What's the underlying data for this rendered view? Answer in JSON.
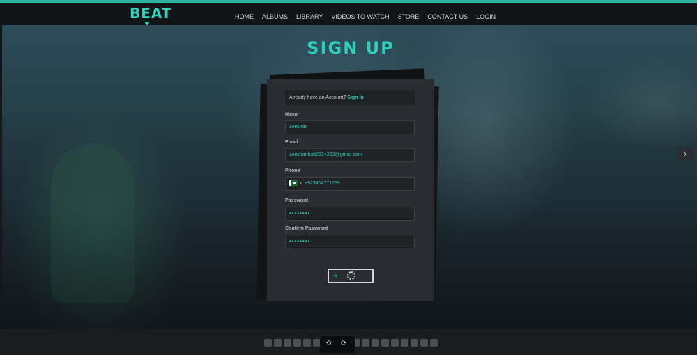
{
  "brand": {
    "name": "BEAT",
    "accent": "#2fc7b3"
  },
  "nav": {
    "items": [
      "HOME",
      "ALBUMS",
      "LIBRARY",
      "VIDEOS TO WATCH",
      "STORE",
      "CONTACT US",
      "LOGIN"
    ]
  },
  "hero": {
    "title": "SIGN UP",
    "next_icon": "chevron-right-icon",
    "next_glyph": "›"
  },
  "form": {
    "signin_text": "Already have an Account?",
    "signin_link": "Sign In",
    "name": {
      "label": "Name",
      "value": "zeeshan"
    },
    "email": {
      "label": "Email",
      "value": "zeeshanbutt223+222@gmail.com"
    },
    "phone": {
      "label": "Phone",
      "value": "+923454771299",
      "country": "PK"
    },
    "password": {
      "label": "Password",
      "value": "••••••••"
    },
    "confirm_password": {
      "label": "Confirm Password",
      "value": "••••••••"
    },
    "submit": {
      "icon": "sign-in-icon",
      "glyph": "⇥",
      "state": "loading"
    }
  },
  "footer": {
    "social_icons": [
      "youtube-icon",
      "twitter-icon",
      "facebook-icon",
      "facebook-icon",
      "instagram-icon",
      "amazon-icon",
      "beatport-icon",
      "tidal-icon",
      "tiktok-icon",
      "soundcloud-icon",
      "deezer-icon",
      "spotify-icon",
      "itunes-icon",
      "bandcamp-icon",
      "google-play-icon",
      "mixcloud-icon",
      "napster-icon",
      "shazam-icon"
    ],
    "player": {
      "prev_icon": "undo-icon",
      "prev_glyph": "⟲",
      "next_icon": "redo-icon",
      "next_glyph": "⟳"
    }
  }
}
